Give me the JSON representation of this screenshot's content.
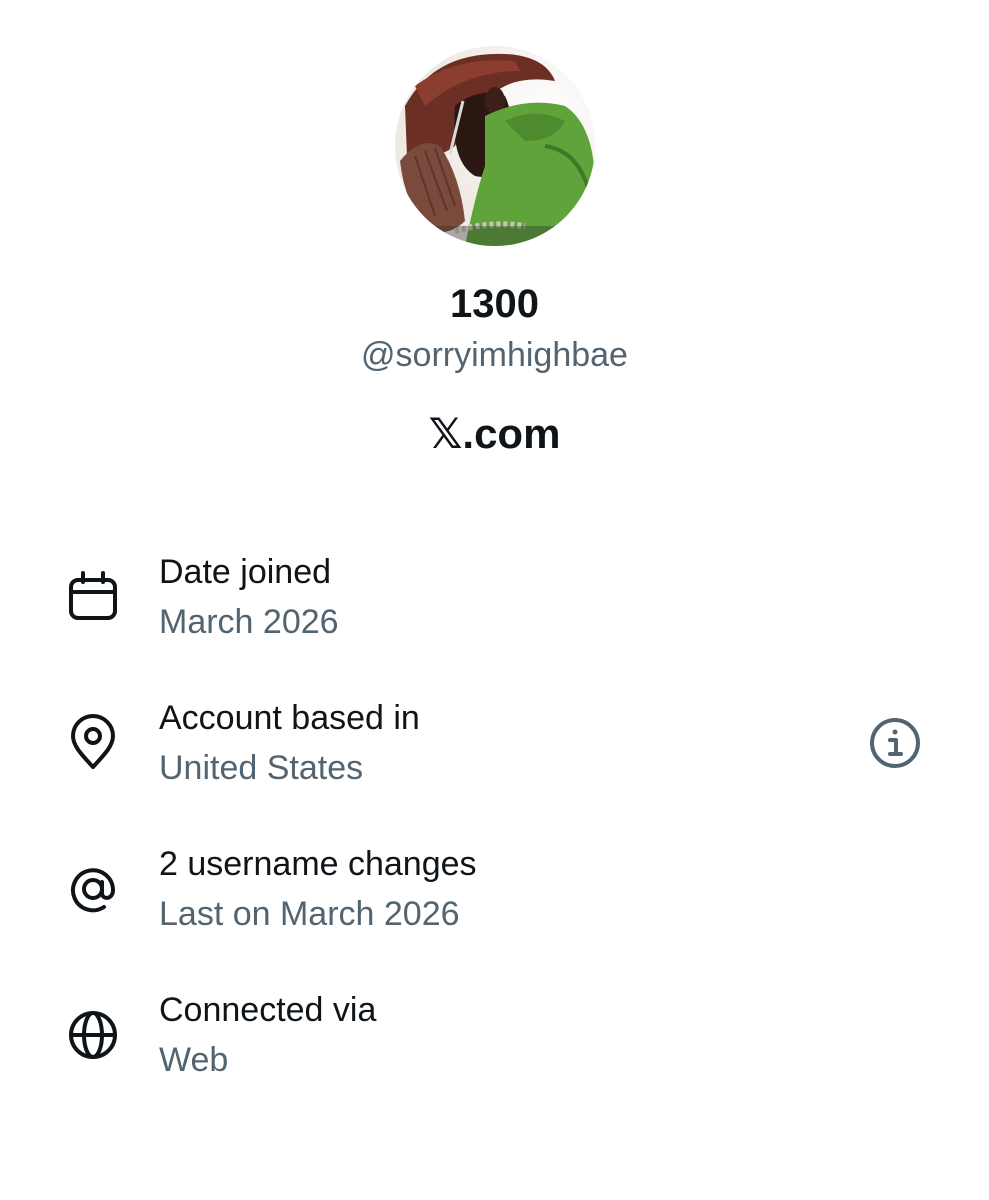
{
  "profile": {
    "display_name": "1300",
    "handle": "@sorryimhighbae",
    "platform": "𝕏.com"
  },
  "details": [
    {
      "icon": "calendar-icon",
      "title": "Date joined",
      "value": "March 2026"
    },
    {
      "icon": "location-pin-icon",
      "title": "Account based in",
      "value": "United States",
      "action_icon": "info-icon"
    },
    {
      "icon": "at-sign-icon",
      "title": "2 username changes",
      "value": "Last on March 2026"
    },
    {
      "icon": "globe-icon",
      "title": "Connected via",
      "value": "Web"
    }
  ],
  "colors": {
    "primary_text": "#0f1419",
    "secondary_text": "#536471",
    "background": "#ffffff"
  }
}
